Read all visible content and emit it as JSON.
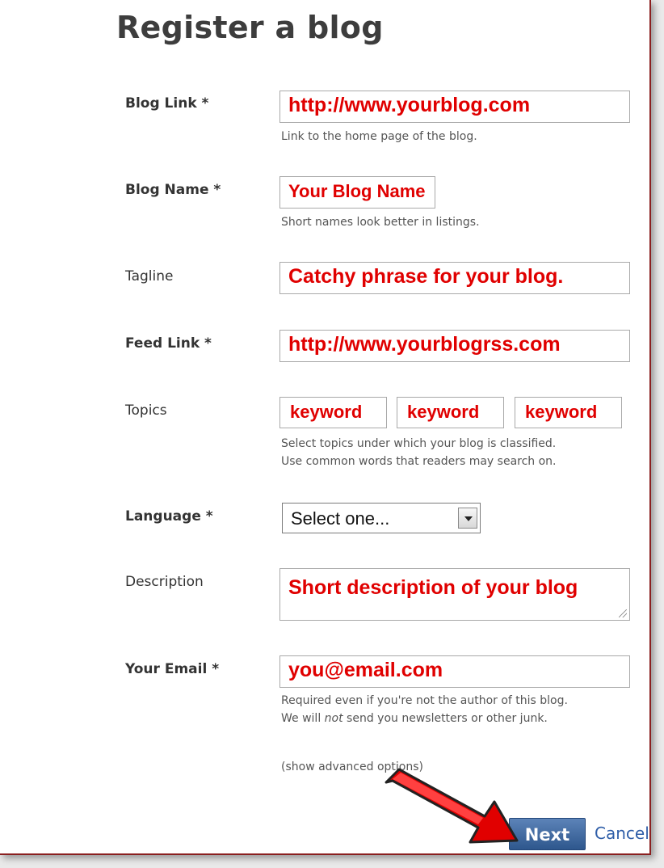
{
  "page": {
    "title": "Register a blog"
  },
  "form": {
    "blog_link": {
      "label": "Blog Link *",
      "value": "http://www.yourblog.com",
      "help": "Link to the home page of the blog."
    },
    "blog_name": {
      "label": "Blog Name *",
      "value": "Your Blog Name",
      "help": "Short names look better in listings."
    },
    "tagline": {
      "label": "Tagline",
      "value": "Catchy phrase for your blog."
    },
    "feed_link": {
      "label": "Feed Link *",
      "value": "http://www.yourblogrss.com"
    },
    "topics": {
      "label": "Topics",
      "values": [
        "keyword",
        "keyword",
        "keyword"
      ],
      "help_line1": "Select topics under which your blog is classified.",
      "help_line2": "Use common words that readers may search on."
    },
    "language": {
      "label": "Language *",
      "selected": "Select one..."
    },
    "description": {
      "label": "Description",
      "value": "Short description of your blog"
    },
    "email": {
      "label": "Your Email *",
      "value": "you@email.com",
      "help_line1": "Required even if you're not the author of this blog.",
      "help_line2_pre": "We will ",
      "help_line2_em": "not",
      "help_line2_post": " send you newsletters or other junk."
    },
    "advanced_link": "(show advanced options)",
    "next_label": "Next",
    "cancel_label": "Cancel"
  },
  "colors": {
    "annotation_red": "#e00000",
    "next_button": "#3b659c",
    "frame_border": "#8a1f1f"
  },
  "icons": {
    "select_dropdown": "chevron-down-icon",
    "annotation_arrow": "arrow-icon"
  }
}
